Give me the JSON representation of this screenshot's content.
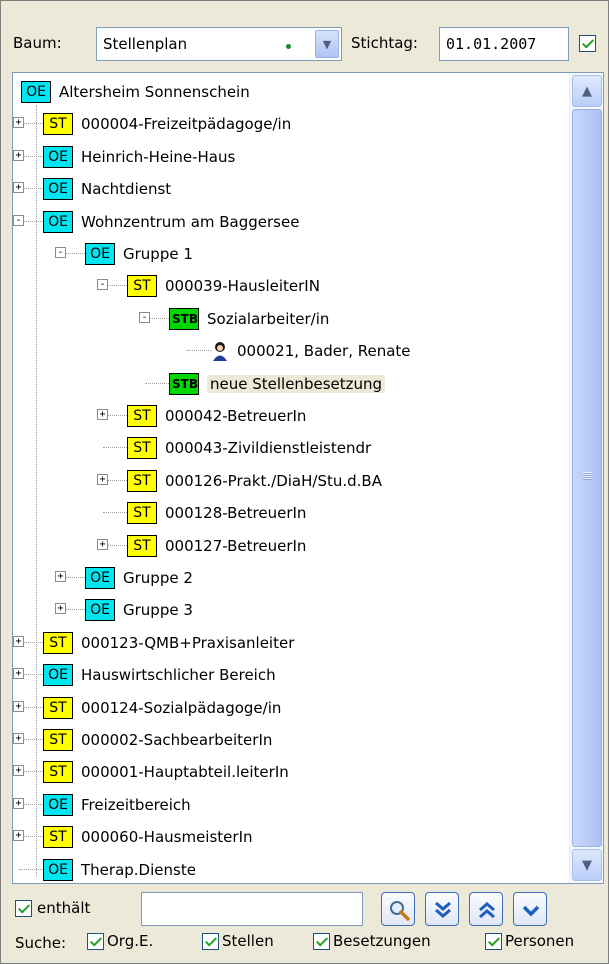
{
  "header": {
    "tree_label": "Baum:",
    "tree_value": "Stellenplan",
    "date_label": "Stichtag:",
    "date_value": "01.01.2007"
  },
  "tree": [
    {
      "depth": 0,
      "type": "OE",
      "label": "Altersheim Sonnenschein",
      "expander": ""
    },
    {
      "depth": 1,
      "type": "ST",
      "label": "000004-Freizeitpädagoge/in",
      "expander": "+"
    },
    {
      "depth": 1,
      "type": "OE",
      "label": "Heinrich-Heine-Haus",
      "expander": "+"
    },
    {
      "depth": 1,
      "type": "OE",
      "label": "Nachtdienst",
      "expander": "+"
    },
    {
      "depth": 1,
      "type": "OE",
      "label": "Wohnzentrum  am Baggersee",
      "expander": "-"
    },
    {
      "depth": 2,
      "type": "OE",
      "label": "Gruppe 1",
      "expander": "-"
    },
    {
      "depth": 3,
      "type": "ST",
      "label": "000039-HausleiterIN",
      "expander": "-"
    },
    {
      "depth": 4,
      "type": "STB",
      "label": "Sozialarbeiter/in",
      "expander": "-"
    },
    {
      "depth": 5,
      "type": "PERSON",
      "label": "000021, Bader, Renate",
      "expander": ""
    },
    {
      "depth": 4,
      "type": "STB",
      "label": "neue Stellenbesetzung",
      "expander": "",
      "selected": true
    },
    {
      "depth": 3,
      "type": "ST",
      "label": "000042-BetreuerIn",
      "expander": "+"
    },
    {
      "depth": 3,
      "type": "ST",
      "label": "000043-Zivildienstleistendr",
      "expander": ""
    },
    {
      "depth": 3,
      "type": "ST",
      "label": "000126-Prakt./DiaH/Stu.d.BA",
      "expander": "+"
    },
    {
      "depth": 3,
      "type": "ST",
      "label": "000128-BetreuerIn",
      "expander": ""
    },
    {
      "depth": 3,
      "type": "ST",
      "label": "000127-BetreuerIn",
      "expander": "+"
    },
    {
      "depth": 2,
      "type": "OE",
      "label": "Gruppe 2",
      "expander": "+"
    },
    {
      "depth": 2,
      "type": "OE",
      "label": "Gruppe 3",
      "expander": "+"
    },
    {
      "depth": 1,
      "type": "ST",
      "label": "000123-QMB+Praxisanleiter",
      "expander": "+"
    },
    {
      "depth": 1,
      "type": "OE",
      "label": "Hauswirtschlicher Bereich",
      "expander": "+"
    },
    {
      "depth": 1,
      "type": "ST",
      "label": "000124-Sozialpädagoge/in",
      "expander": "+"
    },
    {
      "depth": 1,
      "type": "ST",
      "label": "000002-SachbearbeiterIn",
      "expander": "+"
    },
    {
      "depth": 1,
      "type": "ST",
      "label": "000001-Hauptabteil.leiterIn",
      "expander": "+"
    },
    {
      "depth": 1,
      "type": "OE",
      "label": "Freizeitbereich",
      "expander": "+"
    },
    {
      "depth": 1,
      "type": "ST",
      "label": "000060-HausmeisterIn",
      "expander": "+"
    },
    {
      "depth": 1,
      "type": "OE",
      "label": "Therap.Dienste",
      "expander": ""
    }
  ],
  "badge_text": {
    "OE": "OE",
    "ST": "ST",
    "STB": "STB"
  },
  "search": {
    "contains_label": "enthält",
    "input_value": "",
    "search_label": "Suche:",
    "filters": [
      "Org.E.",
      "Stellen",
      "Besetzungen",
      "Personen"
    ]
  },
  "icons": {
    "search": "magnifier-icon",
    "next": "double-chevron-down-icon",
    "prev": "double-chevron-up-icon",
    "down": "chevron-down-icon"
  }
}
